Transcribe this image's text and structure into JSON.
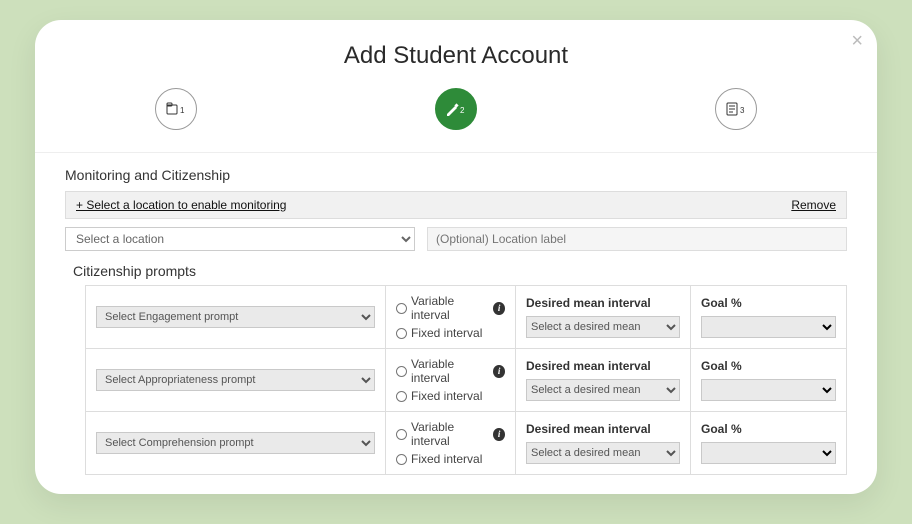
{
  "modal": {
    "title": "Add Student Account",
    "close": "×",
    "section_heading": "Monitoring and Citizenship",
    "enable_link": "+ Select a location to enable monitoring",
    "remove_link": "Remove",
    "location_placeholder": "Select a location",
    "label_placeholder": "(Optional) Location label",
    "citizenship_heading": "Citizenship prompts",
    "interval_variable": "Variable interval",
    "interval_fixed": "Fixed interval",
    "mean_header": "Desired mean interval",
    "mean_placeholder": "Select a desired mean",
    "goal_header": "Goal %",
    "prompts": [
      {
        "placeholder": "Select Engagement prompt"
      },
      {
        "placeholder": "Select Appropriateness prompt"
      },
      {
        "placeholder": "Select Comprehension prompt"
      }
    ]
  }
}
